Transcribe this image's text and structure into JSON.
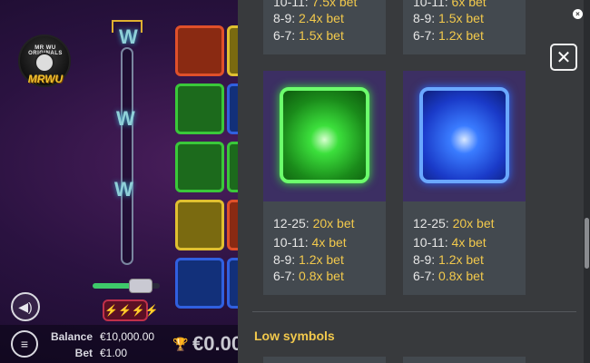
{
  "game": {
    "logo_top": "MR WU ORIGINALS",
    "logo_text": "MRWU",
    "meter_symbol": "W",
    "bonus_symbol": "⚡⚡⚡⚡",
    "balance_label": "Balance",
    "balance_value": "€10,000.00",
    "bet_label": "Bet",
    "bet_value": "€1.00",
    "win_value": "€0.00",
    "sound_icon": "speaker-icon",
    "menu_icon": "hamburger-icon",
    "trophy_icon": "trophy-icon"
  },
  "paytable": {
    "top_cards": [
      {
        "lines": [
          {
            "range": "10-11: ",
            "mult": "7.5x bet"
          },
          {
            "range": "8-9: ",
            "mult": "2.4x bet"
          },
          {
            "range": "6-7: ",
            "mult": "1.5x bet"
          }
        ]
      },
      {
        "lines": [
          {
            "range": "10-11: ",
            "mult": "6x bet"
          },
          {
            "range": "8-9: ",
            "mult": "1.5x bet"
          },
          {
            "range": "6-7: ",
            "mult": "1.2x bet"
          }
        ]
      }
    ],
    "symbol_cards": [
      {
        "name": "green-gem",
        "color": "#3be03b",
        "lines": [
          {
            "range": "12-25: ",
            "mult": "20x bet"
          },
          {
            "range": "10-11: ",
            "mult": "4x bet"
          },
          {
            "range": "8-9: ",
            "mult": "1.2x bet"
          },
          {
            "range": "6-7: ",
            "mult": "0.8x bet"
          }
        ]
      },
      {
        "name": "blue-gem",
        "color": "#2a6cff",
        "lines": [
          {
            "range": "12-25: ",
            "mult": "20x bet"
          },
          {
            "range": "10-11: ",
            "mult": "4x bet"
          },
          {
            "range": "8-9: ",
            "mult": "1.2x bet"
          },
          {
            "range": "6-7: ",
            "mult": "0.8x bet"
          }
        ]
      }
    ],
    "low_symbols_title": "Low symbols",
    "close_icon": "close-icon"
  },
  "colors": {
    "accent_yellow": "#f2c94c",
    "panel_bg": "#383a3d"
  }
}
